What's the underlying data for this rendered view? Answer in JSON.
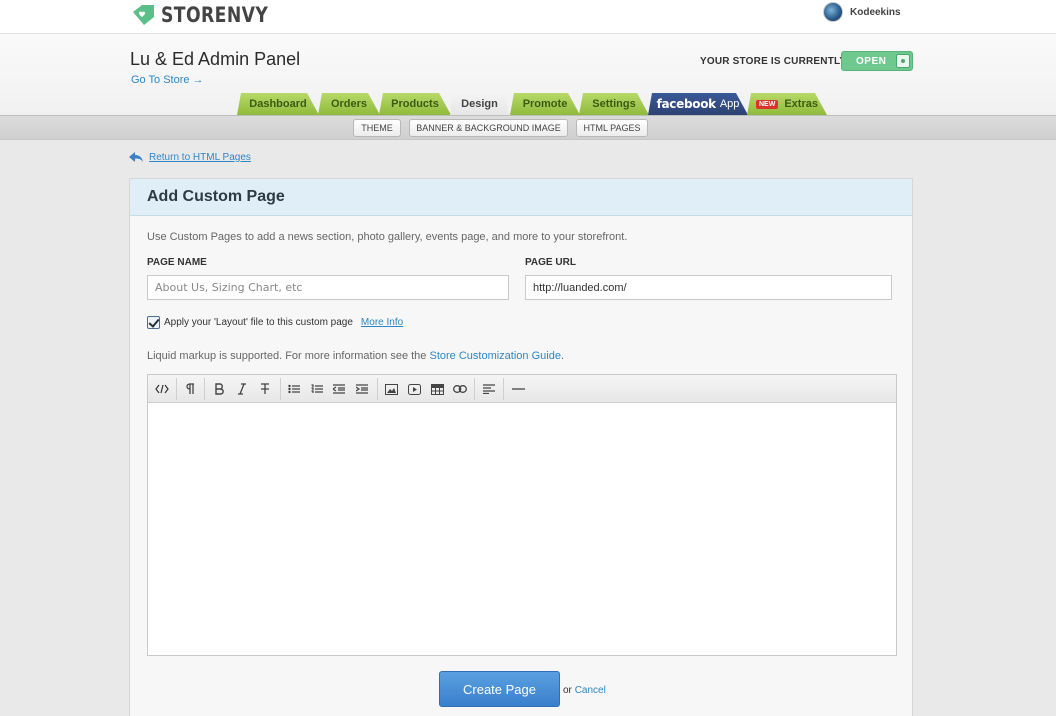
{
  "brand": {
    "name": "STORENVY",
    "accent": "#5cbf8a"
  },
  "user": {
    "name": "Kodeekins"
  },
  "header": {
    "store_title": "Lu & Ed Admin Panel",
    "go_to_store": "Go To Store →",
    "status_label": "YOUR STORE IS CURRENTLY",
    "status_value": "OPEN"
  },
  "tabs": [
    {
      "label": "Dashboard"
    },
    {
      "label": "Orders"
    },
    {
      "label": "Products"
    },
    {
      "label": "Design",
      "active": true
    },
    {
      "label": "Promote"
    },
    {
      "label": "Settings"
    },
    {
      "label": "facebook",
      "suffix": "App"
    },
    {
      "label": "Extras",
      "badge": "NEW"
    }
  ],
  "subnav": [
    {
      "label": "THEME"
    },
    {
      "label": "BANNER & BACKGROUND IMAGE"
    },
    {
      "label": "HTML PAGES"
    }
  ],
  "return_link": "Return to HTML Pages",
  "form": {
    "title": "Add Custom Page",
    "intro": "Use Custom Pages to add a news section, photo gallery, events page, and more to your storefront.",
    "page_name_label": "PAGE NAME",
    "page_name_placeholder": "About Us, Sizing Chart, etc",
    "page_url_label": "PAGE URL",
    "page_url_value": "http://luanded.com/",
    "layout_checkbox_label": "Apply your 'Layout' file to this custom page",
    "layout_checked": true,
    "more_info": "More Info",
    "liquid_text": "Liquid markup is supported. For more information see the",
    "liquid_link": "Store Customization Guide",
    "liquid_end": ".",
    "submit_label": "Create Page",
    "or_text": "or",
    "cancel_label": "Cancel"
  },
  "editor_toolbar": [
    "html-source-icon",
    "paragraph-icon",
    "bold-icon",
    "italic-icon",
    "strikethrough-icon",
    "unordered-list-icon",
    "ordered-list-icon",
    "outdent-icon",
    "indent-icon",
    "image-icon",
    "video-icon",
    "table-icon",
    "link-icon",
    "align-icon",
    "horizontal-rule-icon"
  ]
}
